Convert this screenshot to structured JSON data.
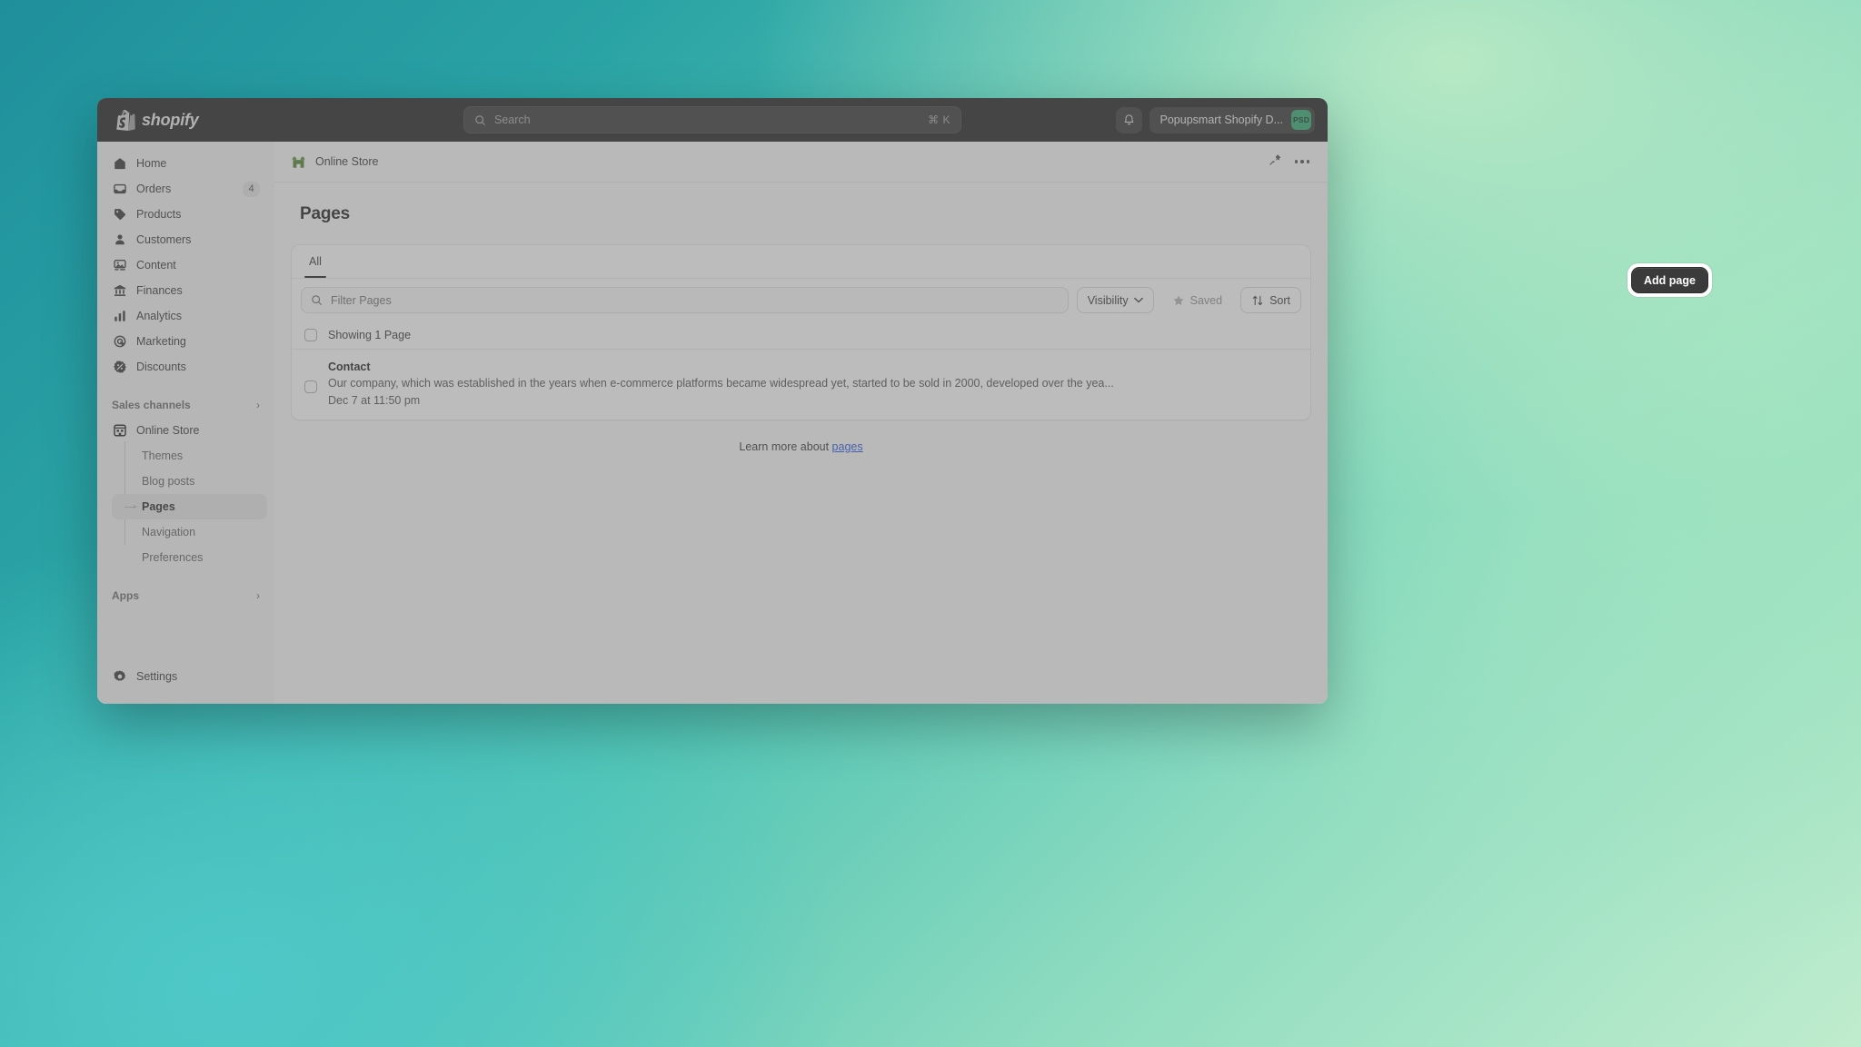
{
  "topbar": {
    "brand": "shopify",
    "search": {
      "placeholder": "Search",
      "shortcut": "⌘ K"
    },
    "notifications_icon": "bell-icon",
    "account_name": "Popupsmart Shopify D...",
    "account_initials": "PSD",
    "accent_avatar_color": "#2aa36a"
  },
  "sidebar": {
    "items": [
      {
        "label": "Home",
        "icon": "home-icon",
        "badge": ""
      },
      {
        "label": "Orders",
        "icon": "orders-icon",
        "badge": "4"
      },
      {
        "label": "Products",
        "icon": "products-tag-icon",
        "badge": ""
      },
      {
        "label": "Customers",
        "icon": "customers-person-icon",
        "badge": ""
      },
      {
        "label": "Content",
        "icon": "content-image-icon",
        "badge": ""
      },
      {
        "label": "Finances",
        "icon": "finances-bank-icon",
        "badge": ""
      },
      {
        "label": "Analytics",
        "icon": "analytics-bars-icon",
        "badge": ""
      },
      {
        "label": "Marketing",
        "icon": "marketing-target-icon",
        "badge": ""
      },
      {
        "label": "Discounts",
        "icon": "discounts-percent-icon",
        "badge": ""
      }
    ],
    "sales_channels": {
      "label": "Sales channels",
      "chevron": "›"
    },
    "online_store": {
      "label": "Online Store",
      "icon": "store-icon"
    },
    "sub_items": [
      {
        "label": "Themes"
      },
      {
        "label": "Blog posts"
      },
      {
        "label": "Pages"
      },
      {
        "label": "Navigation"
      },
      {
        "label": "Preferences"
      }
    ],
    "current_sub_item": "Pages",
    "apps": {
      "label": "Apps",
      "chevron": "›"
    },
    "settings": {
      "label": "Settings",
      "icon": "gear-icon"
    }
  },
  "breadcrumb": {
    "label": "Online Store",
    "icon": "online-store-badge-icon",
    "pin_icon": "pin-icon",
    "more_icon": "more-horizontal-icon"
  },
  "page": {
    "title": "Pages",
    "add_button": "Add page"
  },
  "tabs": [
    {
      "label": "All",
      "active": true
    }
  ],
  "toolbar": {
    "filter_placeholder": "Filter Pages",
    "search_icon": "search-icon",
    "visibility_label": "Visibility",
    "visibility_chevron": "⌄",
    "saved_label": "Saved",
    "saved_icon": "star-icon",
    "sort_label": "Sort",
    "sort_icon": "sort-arrows-icon"
  },
  "list": {
    "showing_label": "Showing 1 Page",
    "rows": [
      {
        "title": "Contact",
        "description": "Our company, which was established in the years when e-commerce platforms became widespread yet, started to be sold in 2000, developed over the yea...",
        "date": "Dec 7 at 11:50 pm"
      }
    ]
  },
  "footer": {
    "learn_prefix": "Learn more about ",
    "learn_link": "pages"
  }
}
